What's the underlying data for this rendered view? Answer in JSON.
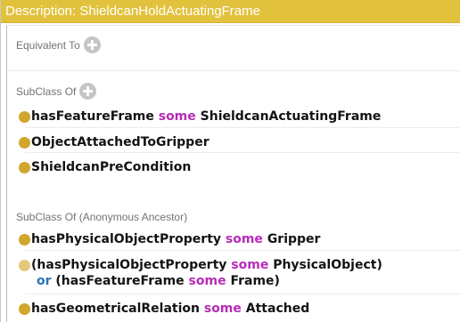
{
  "window": {
    "title": "Description: ShieldcanHoldActuatingFrame"
  },
  "colors": {
    "title_bar": "#e2c23d",
    "bullet": "#d2a52b",
    "keyword_some": "#b62cb8",
    "keyword_or": "#2a73b8"
  },
  "sections": {
    "equivalent_to": {
      "label": "Equivalent To"
    },
    "subclass_of": {
      "label": "SubClass Of",
      "axioms": [
        {
          "property": "hasFeatureFrame",
          "keyword": "some",
          "filler": "ShieldcanActuatingFrame"
        },
        {
          "name": "ObjectAttachedToGripper"
        },
        {
          "name": "ShieldcanPreCondition"
        }
      ]
    },
    "subclass_of_anonymous": {
      "label": "SubClass Of (Anonymous Ancestor)",
      "axioms": [
        {
          "property": "hasPhysicalObjectProperty",
          "keyword": "some",
          "filler": "Gripper"
        },
        {
          "line1_open": "(hasPhysicalObjectProperty",
          "line1_keyword": "some",
          "line1_filler": "PhysicalObject)",
          "line2_or": "or",
          "line2_open": "(hasFeatureFrame",
          "line2_keyword": "some",
          "line2_filler": "Frame)"
        },
        {
          "property": "hasGeometricalRelation",
          "keyword": "some",
          "filler": "Attached"
        }
      ]
    }
  },
  "icons": {
    "add": "plus-circle-icon",
    "bullet": "class-bullet-icon"
  }
}
